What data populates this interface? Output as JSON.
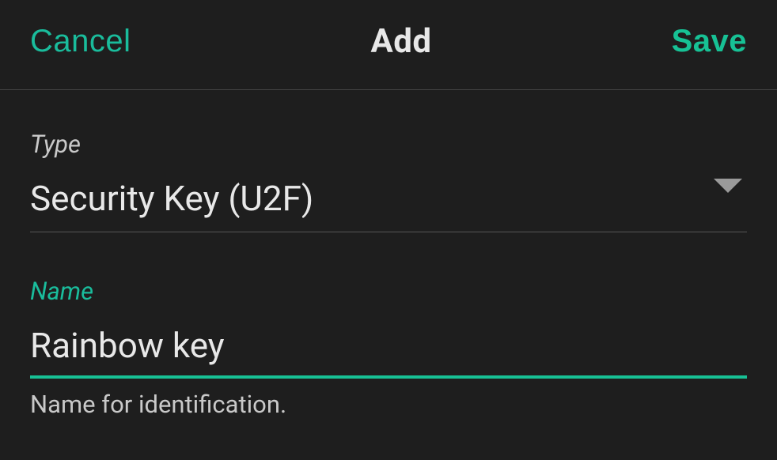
{
  "header": {
    "cancel_label": "Cancel",
    "title": "Add",
    "save_label": "Save"
  },
  "fields": {
    "type": {
      "label": "Type",
      "value": "Security Key (U2F)"
    },
    "name": {
      "label": "Name",
      "value": "Rainbow key",
      "helper": "Name for identification."
    }
  }
}
